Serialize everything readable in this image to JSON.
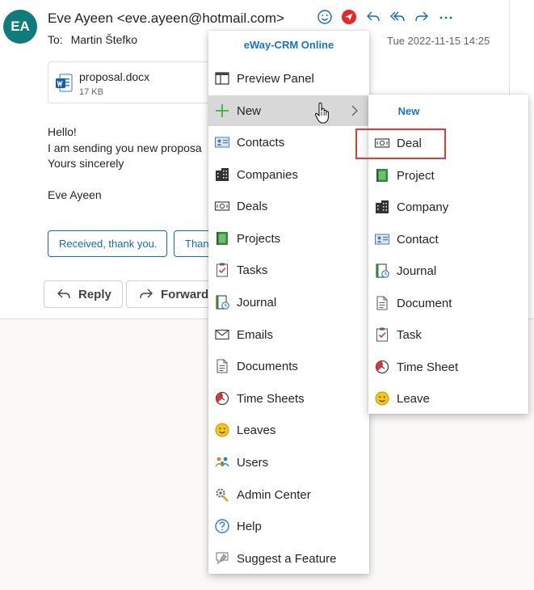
{
  "email": {
    "avatar_initials": "EA",
    "sender": "Eve Ayeen <eve.ayeen@hotmail.com>",
    "to_label": "To:",
    "to_name": "Martin Štefko",
    "date": "Tue 2022-11-15 14:25",
    "attachment": {
      "name": "proposal.docx",
      "size": "17 KB"
    },
    "body": {
      "line1": "Hello!",
      "line2": "I am sending you new proposa",
      "line3": "Yours sincerely",
      "signature": "Eve Ayeen"
    },
    "suggested_replies": [
      "Received, thank you.",
      "Than"
    ],
    "actions": {
      "reply": "Reply",
      "forward": "Forward"
    }
  },
  "toolbar": {
    "icons": [
      "emoji-icon",
      "eway-crm-icon",
      "reply-icon",
      "reply-all-icon",
      "forward-icon",
      "more-icon"
    ]
  },
  "menu": {
    "header": "eWay-CRM Online",
    "items": [
      {
        "label": "Preview Panel",
        "icon": "preview-panel-icon"
      },
      {
        "label": "New",
        "icon": "plus-icon"
      },
      {
        "label": "Contacts",
        "icon": "contact-card-icon"
      },
      {
        "label": "Companies",
        "icon": "building-icon"
      },
      {
        "label": "Deals",
        "icon": "deal-icon"
      },
      {
        "label": "Projects",
        "icon": "project-icon"
      },
      {
        "label": "Tasks",
        "icon": "task-icon"
      },
      {
        "label": "Journal",
        "icon": "journal-icon"
      },
      {
        "label": "Emails",
        "icon": "envelope-icon"
      },
      {
        "label": "Documents",
        "icon": "document-icon"
      },
      {
        "label": "Time Sheets",
        "icon": "timesheet-icon"
      },
      {
        "label": "Leaves",
        "icon": "leave-icon"
      },
      {
        "label": "Users",
        "icon": "users-icon"
      },
      {
        "label": "Admin Center",
        "icon": "admin-icon"
      },
      {
        "label": "Help",
        "icon": "help-icon"
      },
      {
        "label": "Suggest a Feature",
        "icon": "suggest-icon"
      }
    ]
  },
  "submenu": {
    "header": "New",
    "items": [
      {
        "label": "Deal",
        "icon": "deal-icon"
      },
      {
        "label": "Project",
        "icon": "project-icon"
      },
      {
        "label": "Company",
        "icon": "building-icon"
      },
      {
        "label": "Contact",
        "icon": "contact-card-icon"
      },
      {
        "label": "Journal",
        "icon": "journal-icon"
      },
      {
        "label": "Document",
        "icon": "document-icon"
      },
      {
        "label": "Task",
        "icon": "task-icon"
      },
      {
        "label": "Time Sheet",
        "icon": "timesheet-icon"
      },
      {
        "label": "Leave",
        "icon": "leave-icon"
      }
    ]
  },
  "colors": {
    "accent": "#0f6cbd",
    "menu_header": "#1a73c8",
    "avatar_bg": "#0f7b7b",
    "highlight": "#e03a3a",
    "active_item_bg": "#d8d8d8"
  }
}
